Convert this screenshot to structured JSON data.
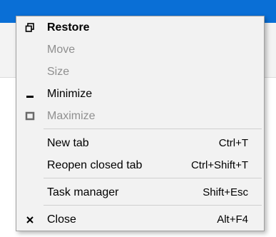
{
  "window": {
    "titlebar_color": "#0a6fd6"
  },
  "menu": {
    "items": [
      {
        "label": "Restore",
        "shortcut": "",
        "icon": "restore-icon",
        "disabled": false,
        "bold": true
      },
      {
        "label": "Move",
        "shortcut": "",
        "icon": "",
        "disabled": true,
        "bold": false
      },
      {
        "label": "Size",
        "shortcut": "",
        "icon": "",
        "disabled": true,
        "bold": false
      },
      {
        "label": "Minimize",
        "shortcut": "",
        "icon": "minimize-icon",
        "disabled": false,
        "bold": false
      },
      {
        "label": "Maximize",
        "shortcut": "",
        "icon": "maximize-icon",
        "disabled": true,
        "bold": false
      },
      {
        "label": "New tab",
        "shortcut": "Ctrl+T",
        "icon": "",
        "disabled": false,
        "bold": false
      },
      {
        "label": "Reopen closed tab",
        "shortcut": "Ctrl+Shift+T",
        "icon": "",
        "disabled": false,
        "bold": false
      },
      {
        "label": "Task manager",
        "shortcut": "Shift+Esc",
        "icon": "",
        "disabled": false,
        "bold": false
      },
      {
        "label": "Close",
        "shortcut": "Alt+F4",
        "icon": "close-icon",
        "disabled": false,
        "bold": false
      }
    ]
  }
}
